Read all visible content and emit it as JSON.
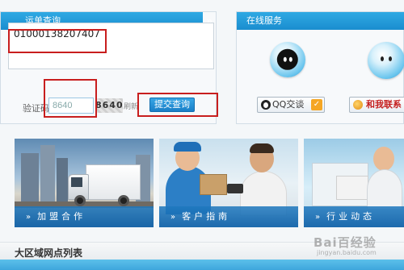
{
  "tracking": {
    "title": "运单查询",
    "tracking_number": "01000138207407",
    "captcha_label": "验证码",
    "captcha_value": "8640",
    "captcha_image_text": "8640",
    "refresh_label": "刷新",
    "submit_label": "提交查询"
  },
  "service": {
    "title": "在线服务",
    "qq_label": "QQ交谈",
    "contact_label": "和我联系"
  },
  "tiles": [
    {
      "label": "加盟合作"
    },
    {
      "label": "客户指南"
    },
    {
      "label": "行业动态"
    }
  ],
  "list": {
    "title": "大区域网点列表"
  },
  "watermark": {
    "text": "Bai百经验",
    "sub": "jingyan.baidu.com"
  },
  "colors": {
    "accent_blue": "#1a8dcf",
    "highlight_red": "#c81e1e",
    "caption_blue": "#1e78be"
  },
  "icons": {
    "header_arrow": "double-chevron-right-icon",
    "qq": "qq-penguin-icon",
    "contact": "contact-icon"
  }
}
